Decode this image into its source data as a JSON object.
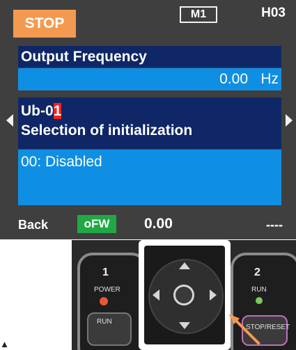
{
  "status": {
    "mode": "STOP",
    "monitor_tag": "M1",
    "code_tag": "H03"
  },
  "monitor": {
    "label": "Output Frequency",
    "value": "0.00",
    "unit": "Hz"
  },
  "parameter": {
    "code_prefix": "Ub-0",
    "code_cursor_digit": "1",
    "name": "Selection of initialization",
    "selected_option": "00: Disabled"
  },
  "softkeys": {
    "left": "Back",
    "direction_badge": "oFW",
    "middle_value": "0.00",
    "right": "----"
  },
  "keypad": {
    "key1_num": "1",
    "key1_label": "POWER",
    "key1_run": "RUN",
    "key2_num": "2",
    "key2_label": "RUN",
    "key2_stop": "STOP/RESET"
  },
  "colors": {
    "mode_badge": "#f39a50",
    "panel_dark": "#0f2766",
    "panel_blue": "#0f8fe3",
    "cursor_highlight": "#ff1f1f",
    "direction_badge": "#21a845",
    "screen_background": "#3f3f3f"
  }
}
